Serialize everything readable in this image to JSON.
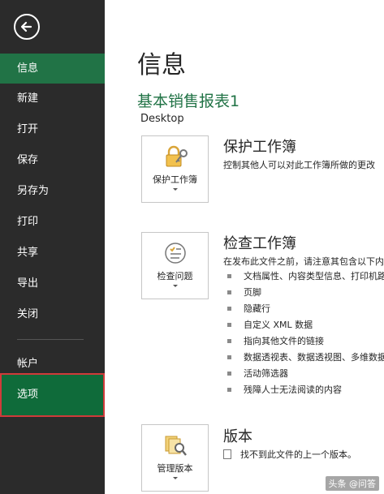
{
  "sidebar": {
    "back_icon": "back-arrow-icon",
    "items": [
      {
        "label": "信息"
      },
      {
        "label": "新建"
      },
      {
        "label": "打开"
      },
      {
        "label": "保存"
      },
      {
        "label": "另存为"
      },
      {
        "label": "打印"
      },
      {
        "label": "共享"
      },
      {
        "label": "导出"
      },
      {
        "label": "关闭"
      }
    ],
    "account_label": "帐户",
    "options_label": "选项",
    "active_color": "#217346",
    "background_color": "#2b2b2b"
  },
  "main": {
    "title": "信息",
    "doc_name": "基本销售报表1",
    "doc_path": "Desktop",
    "protect": {
      "button_label": "保护工作簿",
      "icon": "lock-key-icon",
      "title": "保护工作簿",
      "description": "控制其他人可以对此工作簿所做的更改"
    },
    "inspect": {
      "button_label": "检查问题",
      "icon": "checklist-icon",
      "title": "检查工作簿",
      "description": "在发布此文件之前，请注意其包含以下内容",
      "items": [
        "文档属性、内容类型信息、打印机路径",
        "页脚",
        "隐藏行",
        "自定义 XML 数据",
        "指向其他文件的链接",
        "数据透视表、数据透视图、多维数据集",
        "活动筛选器",
        "残障人士无法阅读的内容"
      ]
    },
    "versions": {
      "button_label": "管理版本",
      "icon": "versions-search-icon",
      "title": "版本",
      "status": "找不到此文件的上一个版本。"
    }
  },
  "watermark": "头条 @问答"
}
